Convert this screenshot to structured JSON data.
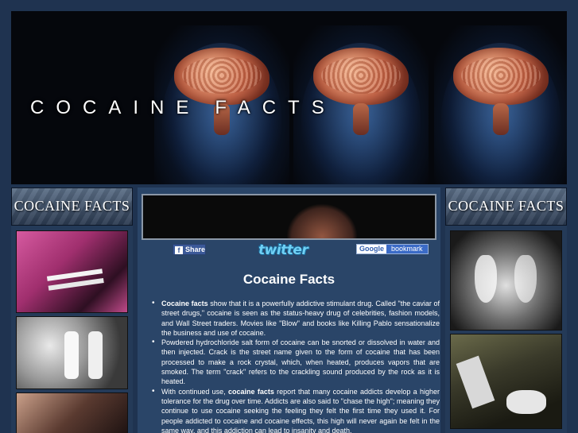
{
  "banner": {
    "title_word1": "COCAINE",
    "title_word2": "FACTS"
  },
  "left_column": {
    "header": "COCAINE FACTS"
  },
  "right_column": {
    "header": "COCAINE FACTS"
  },
  "social": {
    "facebook_label": "Share",
    "facebook_icon": "f",
    "twitter_label": "twitter",
    "google_prefix": "Google",
    "google_label": "bookmark"
  },
  "main": {
    "heading": "Cocaine Facts",
    "bullets": [
      {
        "lead": "Cocaine facts",
        "text": " show that it is a powerfully addictive stimulant drug. Called \"the caviar of street drugs,\" cocaine is seen as the status-heavy drug of celebrities, fashion models, and Wall Street traders. Movies like \"Blow\" and books like Killing Pablo sensationalize the business and use of cocaine."
      },
      {
        "text": "Powdered hydrochloride salt form of cocaine can be snorted or dissolved in water and then injected. Crack is the street name given to the form of cocaine that has been processed to make a rock crystal, which, when heated, produces vapors that are smoked. The term \"crack\" refers to the crackling sound produced by the rock as it is heated."
      },
      {
        "pre": "With continued use, ",
        "lead": "cocaine facts",
        "text": " report that many cocaine addicts develop a higher tolerance for the drug over time. Addicts are also said to \"chase the high\"; meaning they continue to use cocaine seeking the feeling they felt the first time they used it. For people addicted to cocaine and cocaine effects, this high will never again be felt in the same way, and this addiction can lead to insanity and death."
      }
    ]
  }
}
